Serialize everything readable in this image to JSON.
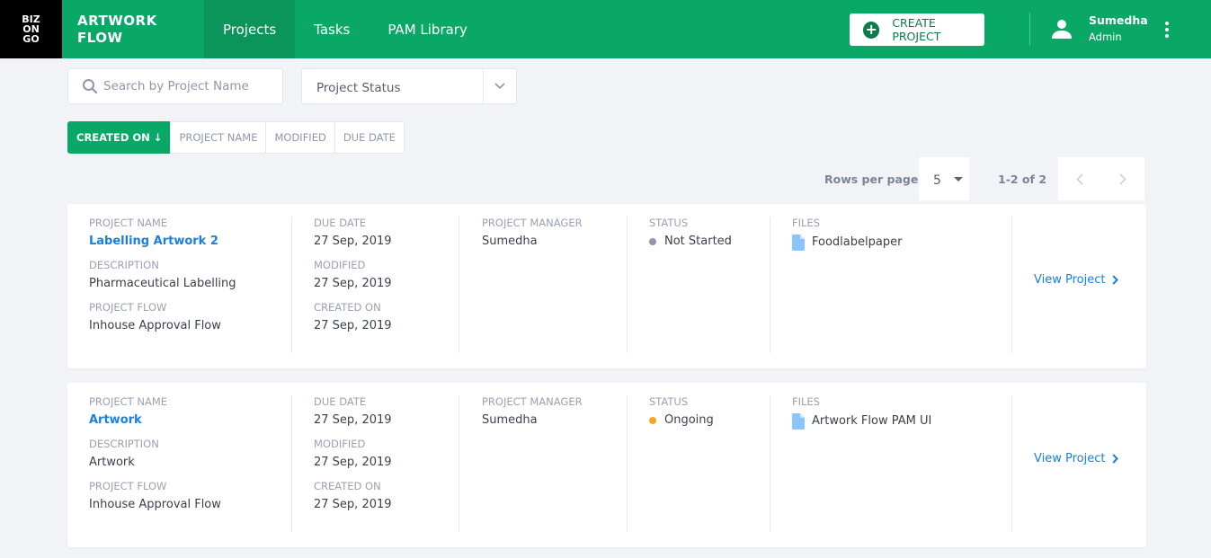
{
  "header": {
    "logo_lines": [
      "BIZ",
      "ON",
      "GO"
    ],
    "brand_line1": "ARTWORK",
    "brand_line2": "FLOW",
    "nav": [
      {
        "label": "Projects",
        "active": true
      },
      {
        "label": "Tasks",
        "active": false
      },
      {
        "label": "PAM Library",
        "active": false
      }
    ],
    "create_button": "Create Project",
    "user": {
      "name": "Sumedha",
      "role": "Admin"
    }
  },
  "filters": {
    "search_placeholder": "Search by Project Name",
    "search_value": "",
    "status_select": "Project Status"
  },
  "sort": {
    "options": [
      "CREATED ON ↓",
      "PROJECT NAME",
      "MODIFIED",
      "DUE DATE"
    ],
    "active_index": 0
  },
  "pagination": {
    "rows_per_page_label": "Rows per page:",
    "rows_per_page": "5",
    "range": "1-2 of 2"
  },
  "labels": {
    "project_name": "PROJECT NAME",
    "description": "DESCRIPTION",
    "project_flow": "PROJECT FLOW",
    "due_date": "DUE DATE",
    "modified": "MODIFIED",
    "created_on": "CREATED ON",
    "project_manager": "PROJECT MANAGER",
    "status": "STATUS",
    "files": "FILES",
    "view_project": "View Project"
  },
  "colors": {
    "primary": "#0aa866",
    "link": "#1a7fe0",
    "status_not_started": "#9095b0",
    "status_ongoing": "#f5a623"
  },
  "projects": [
    {
      "name": "Labelling Artwork 2",
      "description": "Pharmaceutical Labelling",
      "flow": "Inhouse Approval Flow",
      "due_date": "27 Sep, 2019",
      "modified": "27 Sep, 2019",
      "created_on": "27 Sep, 2019",
      "manager": "Sumedha",
      "status": "Not Started",
      "status_color": "#9095b0",
      "file": "Foodlabelpaper"
    },
    {
      "name": "Artwork",
      "description": "Artwork",
      "flow": "Inhouse Approval Flow",
      "due_date": "27 Sep, 2019",
      "modified": "27 Sep, 2019",
      "created_on": "27 Sep, 2019",
      "manager": "Sumedha",
      "status": "Ongoing",
      "status_color": "#f5a623",
      "file": "Artwork Flow PAM UI"
    }
  ]
}
